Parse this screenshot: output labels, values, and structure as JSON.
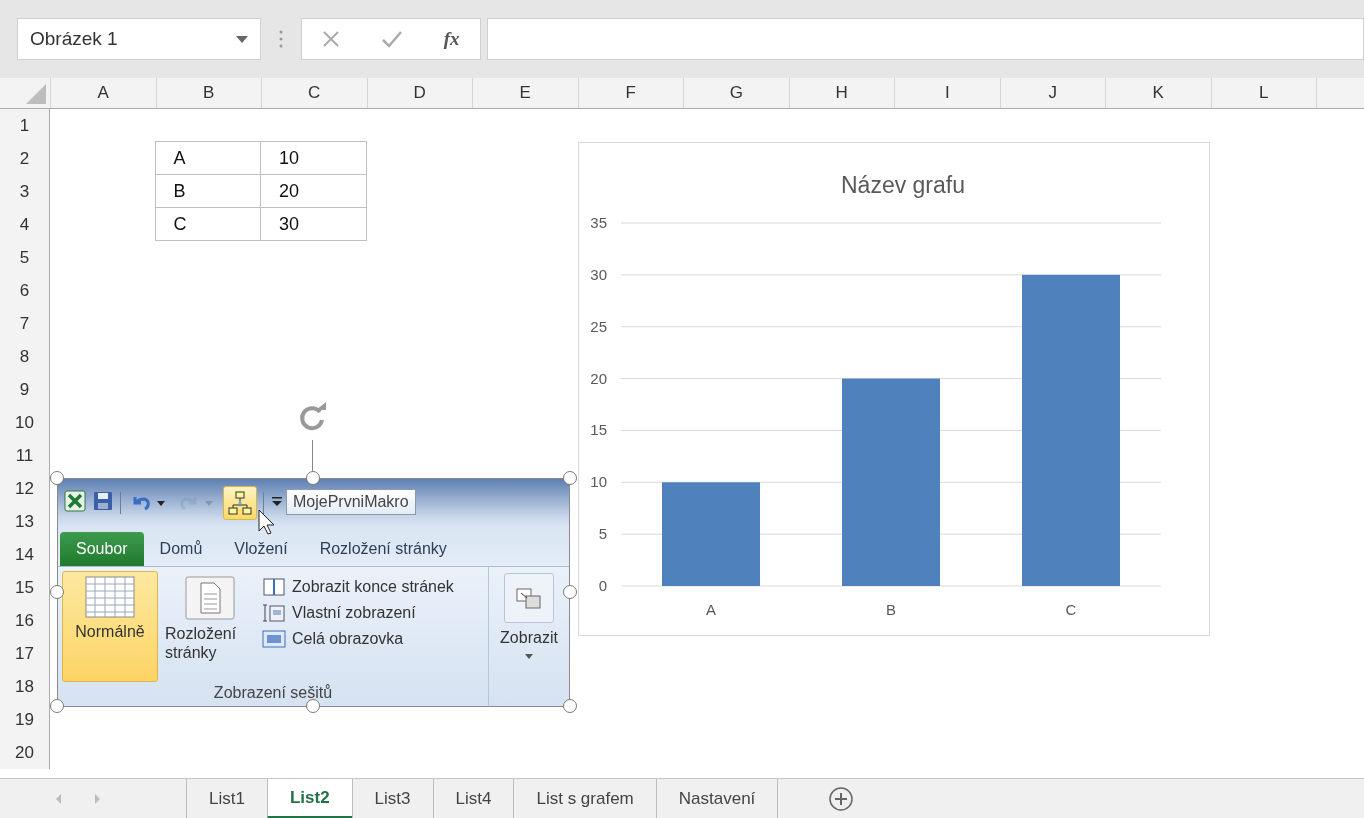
{
  "name_box": {
    "value": "Obrázek 1"
  },
  "formula_bar": {
    "function_label": "fx"
  },
  "columns": [
    "A",
    "B",
    "C",
    "D",
    "E",
    "F",
    "G",
    "H",
    "I",
    "J",
    "K",
    "L"
  ],
  "rows": [
    "1",
    "2",
    "3",
    "4",
    "5",
    "6",
    "7",
    "8",
    "9",
    "10",
    "11",
    "12",
    "13",
    "14",
    "15",
    "16",
    "17",
    "18",
    "19",
    "20"
  ],
  "table": {
    "rows": [
      [
        "A",
        "10"
      ],
      [
        "B",
        "20"
      ],
      [
        "C",
        "30"
      ]
    ]
  },
  "chart": {
    "chart_data": {
      "type": "bar",
      "grid": true,
      "title": "Název grafu",
      "categories": [
        "A",
        "B",
        "C"
      ],
      "values": [
        10,
        20,
        30
      ],
      "ylim": [
        0,
        35
      ],
      "yticks": [
        0,
        5,
        10,
        15,
        20,
        25,
        30,
        35
      ]
    }
  },
  "picture": {
    "quick_access": [
      {
        "kind": "excel"
      },
      {
        "kind": "save"
      },
      {
        "kind": "undo",
        "disabled": false
      },
      {
        "kind": "redo",
        "disabled": true
      },
      {
        "kind": "macro",
        "highlighted": true
      },
      {
        "kind": "customize"
      }
    ],
    "tooltip": "MojePrvniMakro",
    "tabs": [
      {
        "label": "Soubor",
        "kind": "file",
        "selected": false
      },
      {
        "label": "Domů",
        "kind": "tab",
        "selected": false
      },
      {
        "label": "Vložení",
        "kind": "tab",
        "selected": false
      },
      {
        "label": "Rozložení stránky",
        "kind": "tab",
        "selected": false
      }
    ],
    "large_buttons": [
      {
        "label": "Normálně",
        "kind": "normal",
        "selected": true
      },
      {
        "label": "Rozložení stránky",
        "kind": "page",
        "selected": false
      }
    ],
    "small_buttons": [
      {
        "label": "Zobrazit konce stránek",
        "kind": "breaks"
      },
      {
        "label": "Vlastní zobrazení",
        "kind": "custom"
      },
      {
        "label": "Celá obrazovka",
        "kind": "full"
      }
    ],
    "group_label": "Zobrazení sešitů",
    "show_button": {
      "label": "Zobrazit"
    }
  },
  "sheet_tabs": [
    {
      "label": "List1",
      "selected": false
    },
    {
      "label": "List2",
      "selected": true
    },
    {
      "label": "List3",
      "selected": false
    },
    {
      "label": "List4",
      "selected": false
    },
    {
      "label": "List s grafem",
      "selected": false
    },
    {
      "label": "Nastavení",
      "selected": false
    }
  ]
}
